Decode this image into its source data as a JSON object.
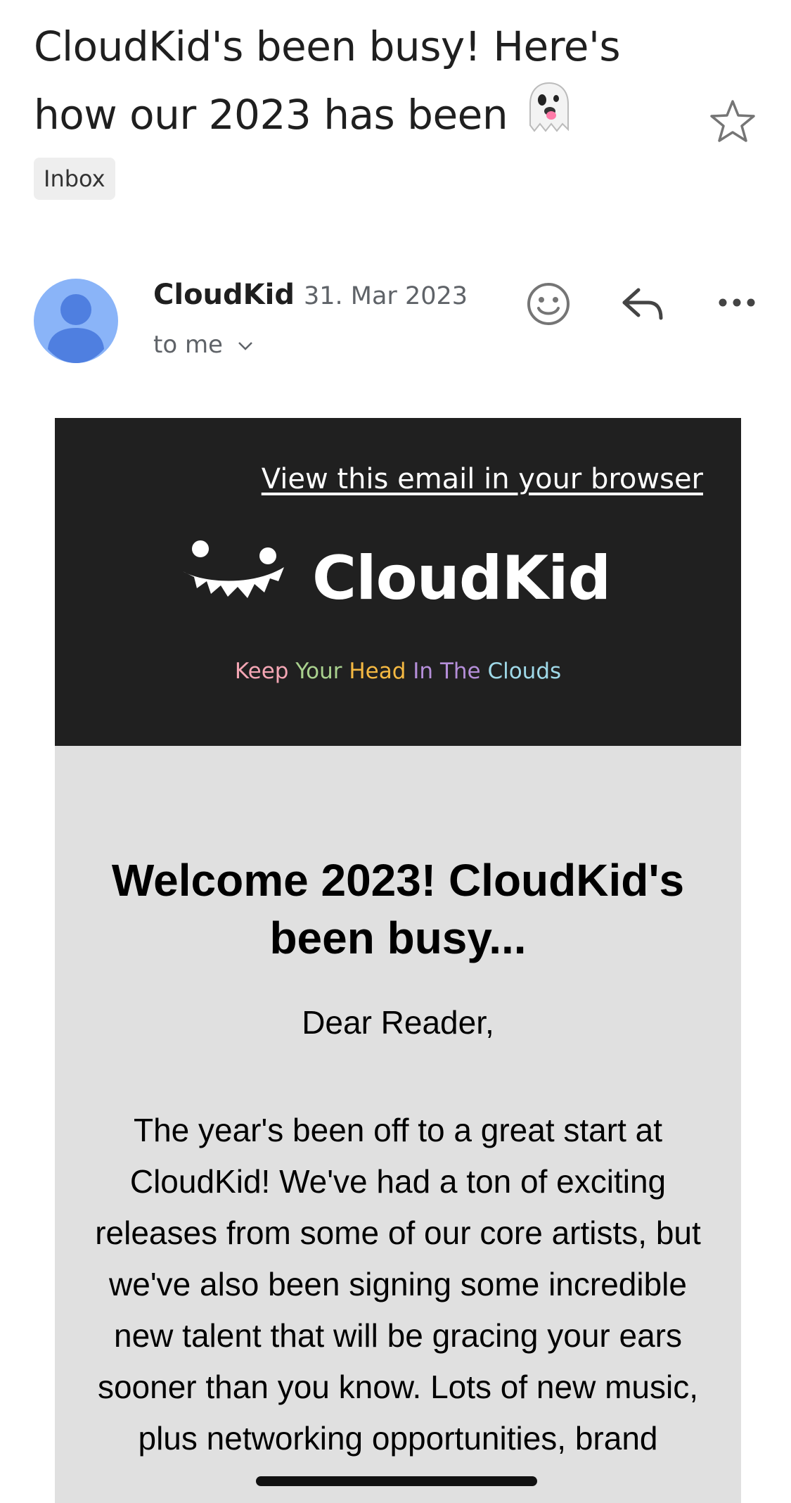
{
  "email": {
    "subject_line1": "CloudKid's been busy! Here's",
    "subject_line2": "how our 2023 has been",
    "subject_emoji": "ghost-emoji",
    "label": "Inbox",
    "sender": "CloudKid",
    "date": "31. Mar 2023",
    "recipient": "to me"
  },
  "actions": {
    "star": "star-icon",
    "emoji": "emoji-smile-icon",
    "reply": "reply-icon",
    "more": "more-horizontal-icon"
  },
  "newsletter": {
    "view_in_browser": "View this email in your browser",
    "brand": "CloudKid",
    "tagline": [
      {
        "text": "Keep",
        "color": "#f4a6b4"
      },
      {
        "text": "Your",
        "color": "#a9d18e"
      },
      {
        "text": "Head",
        "color": "#f5b942"
      },
      {
        "text": "In",
        "color": "#b58ed9"
      },
      {
        "text": "The",
        "color": "#b58ed9"
      },
      {
        "text": "Clouds",
        "color": "#9fd9e8"
      }
    ],
    "headline": "Welcome 2023! CloudKid's been busy...",
    "greeting": "Dear Reader,",
    "paragraph": "The year's been off to a great start at CloudKid! We've had a ton of exciting releases from some of our core artists, but we've also been signing some incredible new talent that will be gracing your ears sooner than you know. Lots of new music, plus networking opportunities, brand"
  },
  "colors": {
    "header_bg": "#202020",
    "body_bg": "#e0e0e0",
    "avatar_bg": "#8ab4f8",
    "avatar_fg": "#4f7fe0"
  }
}
